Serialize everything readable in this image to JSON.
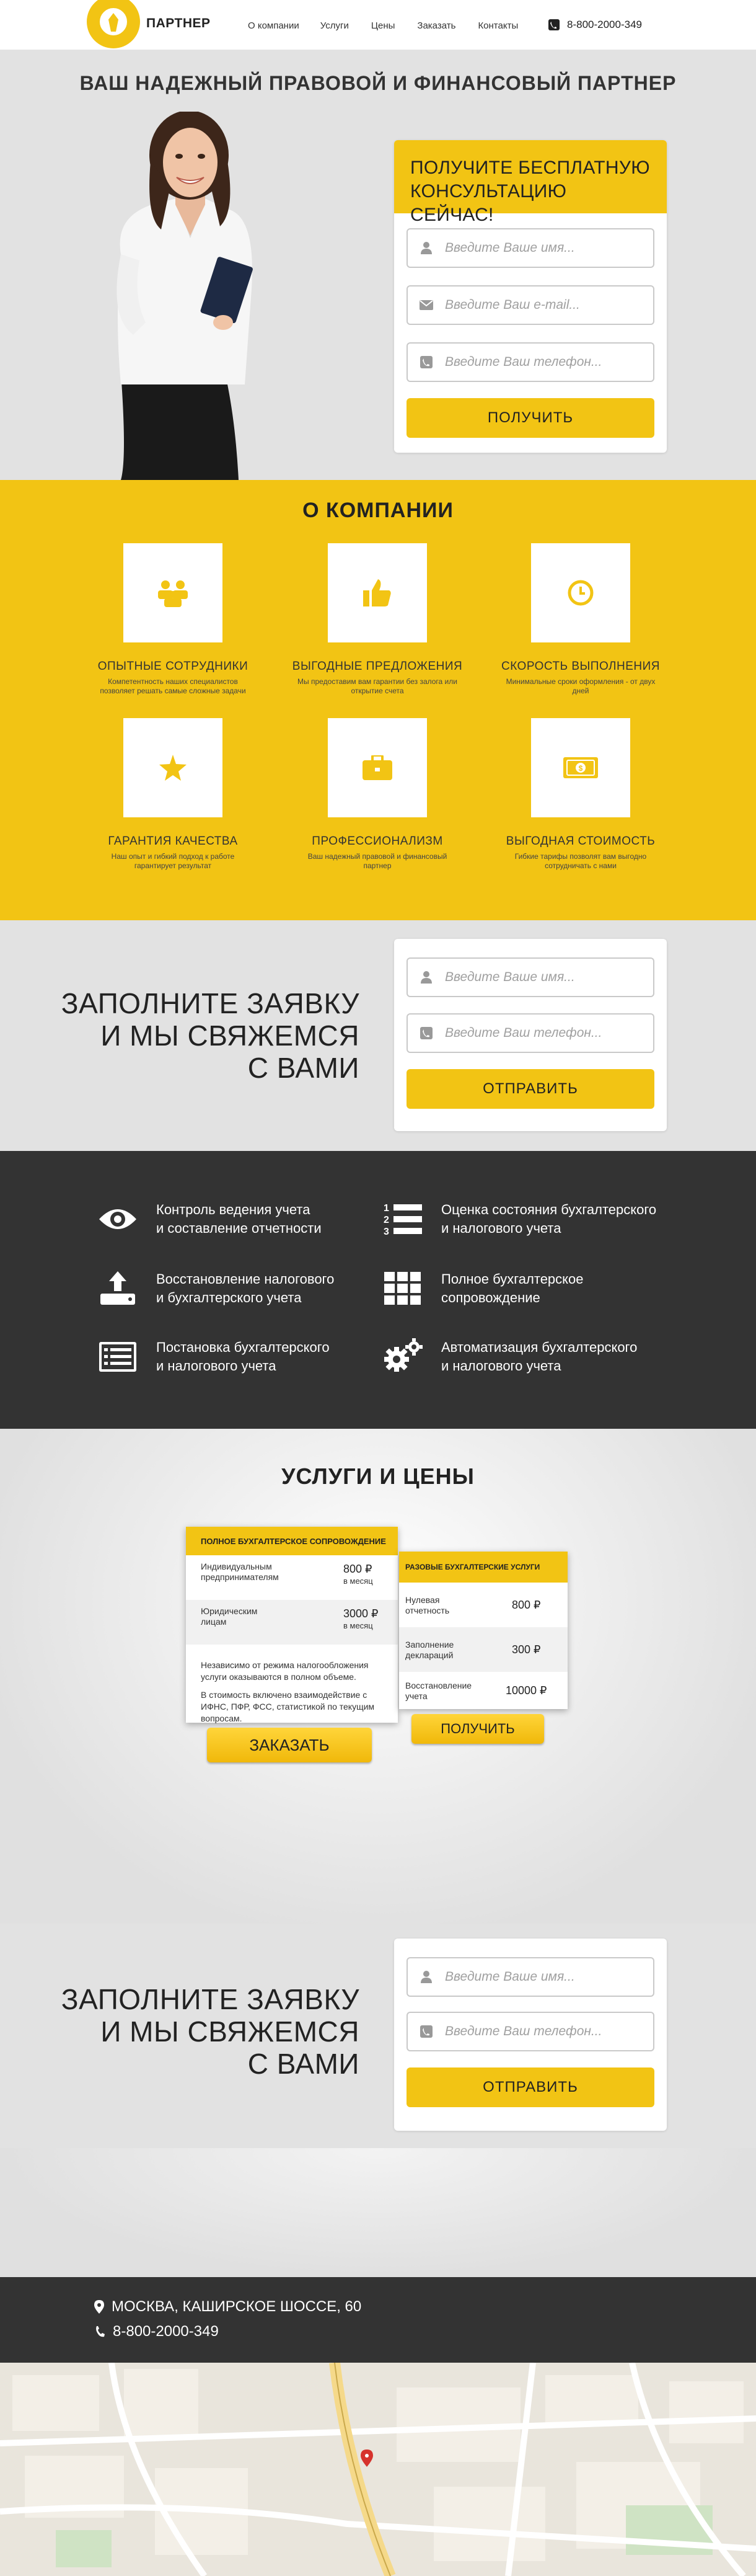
{
  "header": {
    "logo_text": "ПАРТНЕР",
    "nav": [
      "О компании",
      "Услуги",
      "Цены",
      "Заказать",
      "Контакты"
    ],
    "phone": "8-800-2000-349"
  },
  "hero": {
    "title": "ВАШ НАДЕЖНЫЙ ПРАВОВОЙ И ФИНАНСОВЫЙ ПАРТНЕР",
    "form_title_line1": "ПОЛУЧИТЕ БЕСПЛАТНУЮ",
    "form_title_line2": "КОНСУЛЬТАЦИЮ СЕЙЧАС!",
    "name_placeholder": "Введите Ваше имя...",
    "email_placeholder": "Введите Ваш e-mail...",
    "phone_placeholder": "Введите Ваш телефон...",
    "submit": "ПОЛУЧИТЬ"
  },
  "about": {
    "title": "О КОМПАНИИ",
    "features": [
      {
        "title": "ОПЫТНЫЕ СОТРУДНИКИ",
        "desc": "Компетентность наших специалистов позволяет решать самые сложные задачи",
        "icon": "team-icon"
      },
      {
        "title": "ВЫГОДНЫЕ ПРЕДЛОЖЕНИЯ",
        "desc": "Мы предоставим вам гарантии без залога или открытие счета",
        "icon": "thumbs-up-icon"
      },
      {
        "title": "СКОРОСТЬ ВЫПОЛНЕНИЯ",
        "desc": "Минимальные сроки оформления - от двух дней",
        "icon": "clock-icon"
      },
      {
        "title": "ГАРАНТИЯ КАЧЕСТВА",
        "desc": "Наш опыт и гибкий подход к работе гарантирует результат",
        "icon": "star-icon"
      },
      {
        "title": "ПРОФЕССИОНАЛИЗМ",
        "desc": "Ваш надежный правовой и финансовый партнер",
        "icon": "briefcase-icon"
      },
      {
        "title": "ВЫГОДНАЯ СТОИМОСТЬ",
        "desc": "Гибкие тарифы позволят вам выгодно сотрудничать с нами",
        "icon": "money-icon"
      }
    ]
  },
  "cta": {
    "line1": "ЗАПОЛНИТЕ ЗАЯВКУ",
    "line2": "И МЫ СВЯЖЕМСЯ",
    "line3": "С ВАМИ",
    "name_placeholder": "Введите Ваше имя...",
    "phone_placeholder": "Введите Ваш телефон...",
    "submit": "ОТПРАВИТЬ"
  },
  "services": [
    {
      "line1": "Контроль ведения учета",
      "line2": "и составление отчетности",
      "icon": "eye-icon"
    },
    {
      "line1": "Оценка состояния бухгалтерского",
      "line2": "и налогового учета",
      "icon": "numbered-list-icon"
    },
    {
      "line1": "Восстановление налогового",
      "line2": "и бухгалтерского учета",
      "icon": "upload-icon"
    },
    {
      "line1": "Полное бухгалтерское",
      "line2": "сопровождение",
      "icon": "grid-icon"
    },
    {
      "line1": "Постановка бухгалтерского",
      "line2": "и налогового учета",
      "icon": "list-box-icon"
    },
    {
      "line1": "Автоматизация бухгалтерского",
      "line2": "и налогового учета",
      "icon": "gears-icon"
    }
  ],
  "prices": {
    "title": "УСЛУГИ И ЦЕНЫ",
    "card1": {
      "header": "ПОЛНОЕ БУХГАЛТЕРСКОЕ СОПРОВОЖДЕНИЕ",
      "rows": [
        {
          "name1": "Индивидуальным",
          "name2": "предпринимателям",
          "price": "800 ₽",
          "unit": "в месяц"
        },
        {
          "name1": "Юридическим",
          "name2": "лицам",
          "price": "3000 ₽",
          "unit": "в месяц"
        }
      ],
      "note1": "Независимо от режима налогообложения услуги оказываются в полном объеме.",
      "note2": "В стоимость включено взаимодействие с ИФНС, ПФР, ФСС, статистикой по текущим вопросам.",
      "button": "ЗАКАЗАТЬ"
    },
    "card2": {
      "header": "РАЗОВЫЕ БУХГАЛТЕРСКИЕ УСЛУГИ",
      "rows": [
        {
          "name1": "Нулевая",
          "name2": "отчетность",
          "price": "800 ₽"
        },
        {
          "name1": "Заполнение",
          "name2": "деклараций",
          "price": "300 ₽"
        },
        {
          "name1": "Восстановление",
          "name2": "учета",
          "price": "10000 ₽"
        }
      ],
      "button": "ПОЛУЧИТЬ"
    }
  },
  "cta2": {
    "line1": "ЗАПОЛНИТЕ ЗАЯВКУ",
    "line2": "И МЫ СВЯЖЕМСЯ",
    "line3": "С ВАМИ",
    "name_placeholder": "Введите Ваше имя...",
    "phone_placeholder": "Введите Ваш телефон...",
    "submit": "ОТПРАВИТЬ"
  },
  "footer": {
    "address": "МОСКВА, КАШИРСКОЕ ШОССЕ, 60",
    "phone": "8-800-2000-349"
  },
  "colors": {
    "accent": "#f2c414",
    "dark": "#333333",
    "light_bg": "#e2e2e2"
  }
}
